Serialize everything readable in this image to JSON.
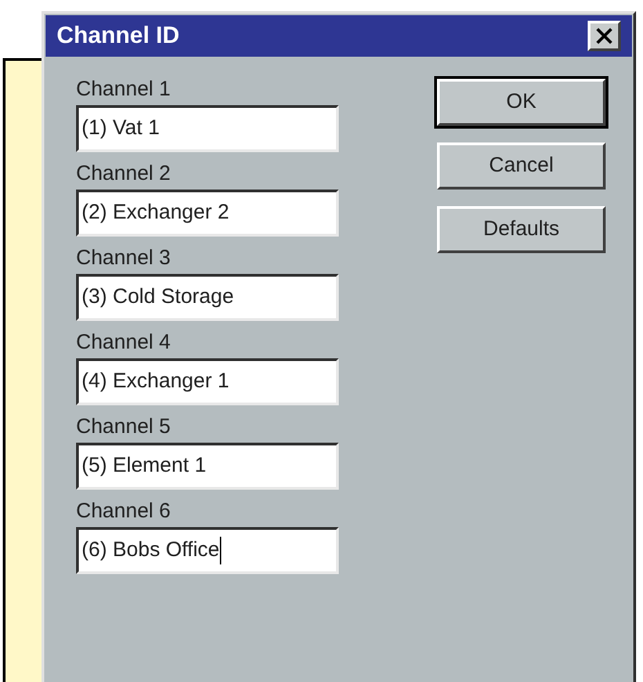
{
  "window": {
    "title": "Channel ID"
  },
  "fields": [
    {
      "label": "Channel 1",
      "value": "(1) Vat 1",
      "focused": false
    },
    {
      "label": "Channel 2",
      "value": "(2) Exchanger 2",
      "focused": false
    },
    {
      "label": "Channel 3",
      "value": "(3) Cold Storage",
      "focused": false
    },
    {
      "label": "Channel 4",
      "value": "(4) Exchanger 1",
      "focused": false
    },
    {
      "label": "Channel 5",
      "value": "(5) Element 1",
      "focused": false
    },
    {
      "label": "Channel 6",
      "value": "(6) Bobs Office",
      "focused": true
    }
  ],
  "buttons": [
    {
      "label": "OK",
      "default": true
    },
    {
      "label": "Cancel",
      "default": false
    },
    {
      "label": "Defaults",
      "default": false
    }
  ]
}
